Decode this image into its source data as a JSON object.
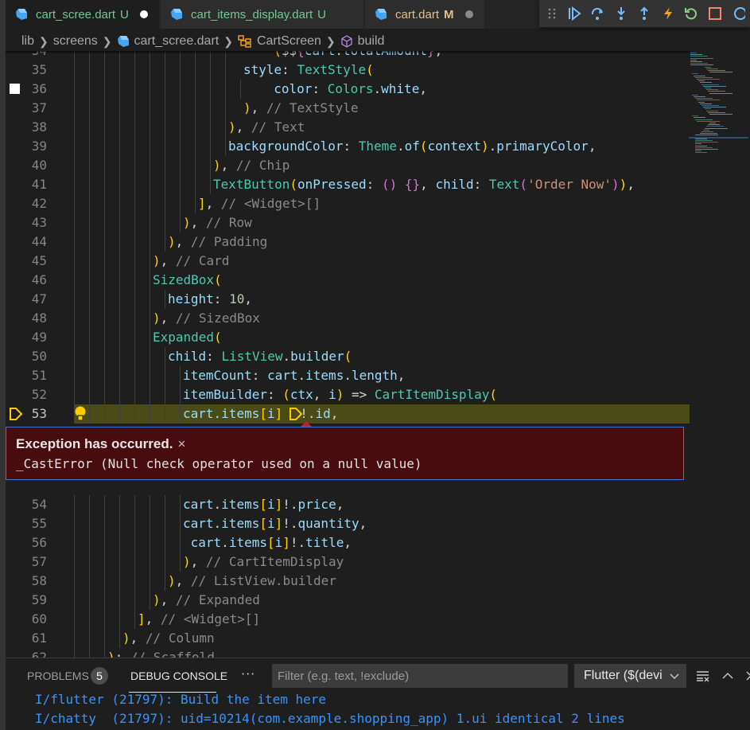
{
  "tabs": [
    {
      "label": "cart_scree.dart",
      "badge": "U",
      "state": "active",
      "status": "untracked",
      "dirty": true
    },
    {
      "label": "cart_items_display.dart",
      "badge": "U",
      "state": "inactive",
      "status": "untracked",
      "dirty": false
    },
    {
      "label": "cart.dart",
      "badge": "M",
      "state": "inactive",
      "status": "modified",
      "dirty": true
    }
  ],
  "debug_toolbar": {
    "buttons": [
      "continue",
      "step-over",
      "step-into",
      "step-out",
      "hot-reload",
      "hot-restart",
      "stop",
      "devtools"
    ]
  },
  "breadcrumb": {
    "items": [
      "lib",
      "screens",
      "cart_scree.dart",
      "CartScreen",
      "build"
    ]
  },
  "editor": {
    "current_line": 53,
    "lines": [
      {
        "n": "34",
        "text": "  ($${cart.totalAmount}',",
        "partial": true
      },
      {
        "n": "35",
        "text": "style: TextStyle("
      },
      {
        "n": "36",
        "text": "  color: Colors.white,"
      },
      {
        "n": "37",
        "text": "), // TextStyle"
      },
      {
        "n": "38",
        "text": "), // Text"
      },
      {
        "n": "39",
        "text": "backgroundColor: Theme.of(context).primaryColor,"
      },
      {
        "n": "40",
        "text": "), // Chip"
      },
      {
        "n": "41",
        "text": "TextButton(onPressed: () {}, child: Text('Order Now')),"
      },
      {
        "n": "42",
        "text": "], // <Widget>[]"
      },
      {
        "n": "43",
        "text": "), // Row"
      },
      {
        "n": "44",
        "text": "), // Padding"
      },
      {
        "n": "45",
        "text": "), // Card"
      },
      {
        "n": "46",
        "text": "SizedBox("
      },
      {
        "n": "47",
        "text": "height: 10,"
      },
      {
        "n": "48",
        "text": "), // SizedBox"
      },
      {
        "n": "49",
        "text": "Expanded("
      },
      {
        "n": "50",
        "text": "child: ListView.builder("
      },
      {
        "n": "51",
        "text": "itemCount: cart.items.length,"
      },
      {
        "n": "52",
        "text": "itemBuilder: (ctx, i) => CartItemDisplay("
      },
      {
        "n": "53",
        "text": "cart.items[i]!.id,"
      },
      {
        "n": "54",
        "text": "cart.items[i]!.price,"
      },
      {
        "n": "55",
        "text": "cart.items[i]!.quantity,"
      },
      {
        "n": "56",
        "text": " cart.items[i]!.title,"
      },
      {
        "n": "57",
        "text": "), // CartItemDisplay"
      },
      {
        "n": "58",
        "text": "), // ListView.builder"
      },
      {
        "n": "59",
        "text": "), // Expanded"
      },
      {
        "n": "60",
        "text": "], // <Widget>[]"
      },
      {
        "n": "61",
        "text": "), // Column"
      },
      {
        "n": "62",
        "text": "); // Scaffold",
        "partial": true
      }
    ]
  },
  "exception": {
    "title": "Exception has occurred.",
    "close": "×",
    "message": "_CastError (Null check operator used on a null value)"
  },
  "panel": {
    "tabs": [
      {
        "label": "PROBLEMS",
        "count": "5"
      },
      {
        "label": "DEBUG CONSOLE",
        "active": true
      }
    ],
    "more": "···",
    "filter_placeholder": "Filter (e.g. text, !exclude)",
    "filter_value": "",
    "session_select": "Flutter ($(devi",
    "console": [
      "I/flutter (21797): Build the item here",
      "I/chatty  (21797): uid=10214(com.example.shopping_app) 1.ui identical 2 lines"
    ]
  },
  "colors": {
    "untracked": "#73c991",
    "modified": "#e2c08d",
    "exception_bg": "#480c0f",
    "current_line": "#4b4b18",
    "console_text": "#3794ff"
  }
}
